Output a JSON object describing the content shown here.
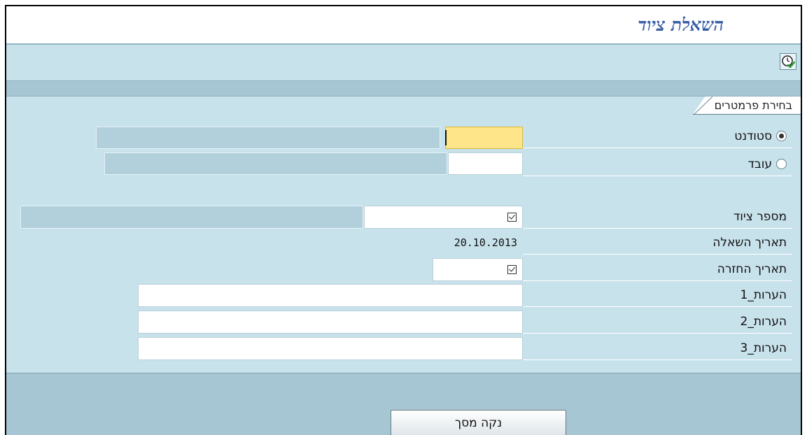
{
  "title": "השאלת ציוד",
  "toolbar": {
    "execute_icon": "execute-clock-check-icon"
  },
  "group": {
    "label": "בחירת פרמטרים"
  },
  "borrower": {
    "student_label": "סטודנט",
    "student_selected": true,
    "employee_label": "עובד",
    "employee_selected": false,
    "student_value": "",
    "employee_value": ""
  },
  "fields": {
    "equipment_number_label": "מספר ציוד",
    "loan_date_label": "תאריך השאלה",
    "loan_date_value": "20.10.2013",
    "return_date_label": "תאריך החזרה",
    "notes1_label": "הערות_1",
    "notes2_label": "הערות_2",
    "notes3_label": "הערות_3"
  },
  "footer": {
    "clear_button_label": "נקה מסך"
  },
  "colors": {
    "background": "#c8e2ec",
    "title": "#3a5fa6",
    "active_field": "#ffe58a",
    "separator": "#a7c6d3"
  }
}
